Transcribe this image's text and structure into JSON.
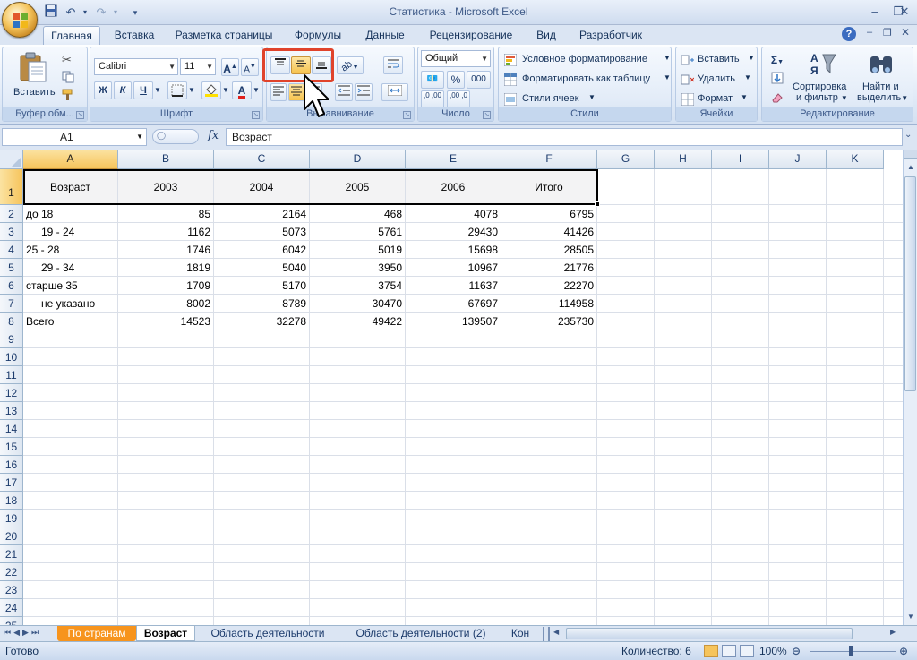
{
  "window": {
    "title": "Статистика - Microsoft Excel",
    "minimize": "–",
    "maximize": "❐",
    "close": "✕"
  },
  "ribbon_tabs": [
    "Главная",
    "Вставка",
    "Разметка страницы",
    "Формулы",
    "Данные",
    "Рецензирование",
    "Вид",
    "Разработчик"
  ],
  "active_tab": "Главная",
  "clipboard": {
    "paste_label": "Вставить",
    "group_label": "Буфер обм..."
  },
  "font": {
    "name": "Calibri",
    "size": "11",
    "grow_label": "A",
    "shrink_label": "A",
    "bold": "Ж",
    "italic": "К",
    "underline": "Ч",
    "font_color_letter": "А",
    "group_label": "Шрифт"
  },
  "alignment": {
    "group_label": "Выравнивание",
    "highlighted_color": "#e0432b"
  },
  "number": {
    "format": "Общий",
    "percent": "%",
    "thousands": "000",
    "dec_increase": ",0 ,00",
    "dec_decrease": ",00 ,0",
    "group_label": "Число"
  },
  "styles": {
    "conditional": "Условное форматирование",
    "as_table": "Форматировать как таблицу",
    "cell_styles": "Стили ячеек",
    "group_label": "Стили"
  },
  "cells": {
    "insert": "Вставить",
    "delete": "Удалить",
    "format": "Формат",
    "group_label": "Ячейки"
  },
  "editing": {
    "sigma": "Σ",
    "sort_label_1": "Сортировка",
    "sort_label_2": "и фильтр",
    "find_label_1": "Найти и",
    "find_label_2": "выделить",
    "group_label": "Редактирование"
  },
  "formula_bar": {
    "name_box": "A1",
    "fx": "fx",
    "content": "Возраст"
  },
  "columns": [
    "A",
    "B",
    "C",
    "D",
    "E",
    "F",
    "G",
    "H",
    "I",
    "J",
    "K"
  ],
  "selected_column": "A",
  "rows": [
    "1",
    "2",
    "3",
    "4",
    "5",
    "6",
    "7",
    "8",
    "9",
    "10",
    "11",
    "12",
    "13",
    "14",
    "15",
    "16",
    "17",
    "18",
    "19",
    "20",
    "21",
    "22",
    "23",
    "24",
    "25"
  ],
  "table": {
    "header": [
      "Возраст",
      "2003",
      "2004",
      "2005",
      "2006",
      "Итого"
    ],
    "data": [
      [
        "до 18",
        "85",
        "2164",
        "468",
        "4078",
        "6795"
      ],
      [
        "19 - 24",
        "1162",
        "5073",
        "5761",
        "29430",
        "41426"
      ],
      [
        "25 - 28",
        "1746",
        "6042",
        "5019",
        "15698",
        "28505"
      ],
      [
        "29 - 34",
        "1819",
        "5040",
        "3950",
        "10967",
        "21776"
      ],
      [
        "старше 35",
        "1709",
        "5170",
        "3754",
        "11637",
        "22270"
      ],
      [
        "не указано",
        "8002",
        "8789",
        "30470",
        "67697",
        "114958"
      ],
      [
        "Всего",
        "14523",
        "32278",
        "49422",
        "139507",
        "235730"
      ]
    ],
    "indented_rows": [
      1,
      3,
      5
    ]
  },
  "sheet_tabs": [
    "По странам",
    "Возраст",
    "Область деятельности",
    "Область деятельности (2)",
    "Кон"
  ],
  "active_sheet": "Возраст",
  "status": {
    "ready": "Готово",
    "count": "Количество: 6",
    "zoom": "100%"
  }
}
